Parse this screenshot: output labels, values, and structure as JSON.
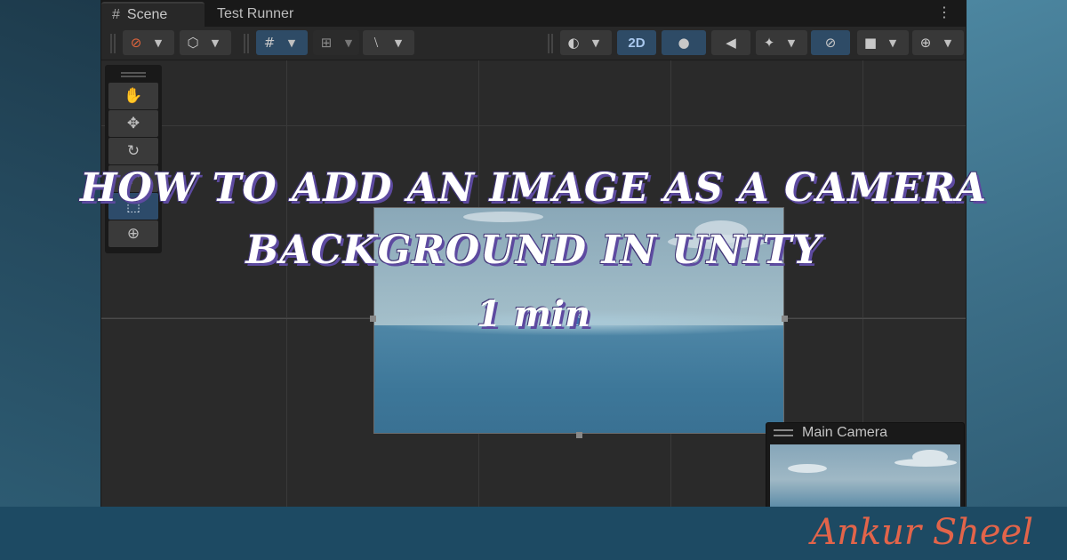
{
  "tabs": [
    {
      "label": "Scene",
      "icon": "hash-icon"
    },
    {
      "label": "Test Runner"
    }
  ],
  "toolbar": {
    "view_2d_label": "2D"
  },
  "tools": [
    "hand-tool-icon",
    "move-tool-icon",
    "rotate-tool-icon",
    "scale-tool-icon",
    "rect-tool-icon",
    "transform-tool-icon"
  ],
  "preview": {
    "title": "Main Camera"
  },
  "overlay": {
    "title_line1": "HOW TO ADD AN IMAGE AS A CAMERA",
    "title_line2": "BACKGROUND IN UNITY",
    "read_time": "1 min"
  },
  "footer": {
    "author": "Ankur Sheel",
    "author_color": "#e2644a"
  }
}
